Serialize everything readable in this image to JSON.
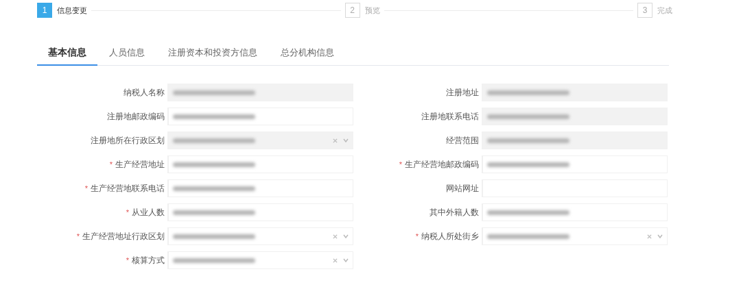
{
  "steps": [
    {
      "number": "1",
      "label": "信息变更",
      "selected": true
    },
    {
      "number": "2",
      "label": "预览",
      "selected": false
    },
    {
      "number": "3",
      "label": "完成",
      "selected": false
    }
  ],
  "tabs": [
    {
      "label": "基本信息",
      "selected": true
    },
    {
      "label": "人员信息",
      "selected": false
    },
    {
      "label": "注册资本和投资方信息",
      "selected": false
    },
    {
      "label": "总分机构信息",
      "selected": false
    }
  ],
  "form_left": [
    {
      "label": "纳税人名称",
      "kind": "readonly",
      "value_redacted": true
    },
    {
      "label": "注册地邮政编码",
      "kind": "input",
      "value_redacted": true
    },
    {
      "label": "注册地所在行政区划",
      "kind": "readonly_select",
      "value_redacted": true
    },
    {
      "label": "生产经营地址",
      "required_mark": "*",
      "kind": "input",
      "value_redacted": true
    },
    {
      "label": "生产经营地联系电话",
      "required_mark": "*",
      "kind": "input",
      "value_redacted": true
    },
    {
      "label": "从业人数",
      "required_mark": "*",
      "kind": "input",
      "value_redacted": true
    },
    {
      "label": "生产经营地址行政区划",
      "required_mark": "*",
      "kind": "select",
      "value_redacted": true
    },
    {
      "label": "核算方式",
      "required_mark": "*",
      "kind": "select",
      "value_redacted": true
    }
  ],
  "form_right": [
    {
      "label": "注册地址",
      "kind": "readonly",
      "value_redacted": true
    },
    {
      "label": "注册地联系电话",
      "kind": "readonly",
      "value_redacted": true
    },
    {
      "label": "经营范围",
      "kind": "readonly",
      "value_redacted": true
    },
    {
      "label": "生产经营地邮政编码",
      "required_mark": "*",
      "kind": "input",
      "value_redacted": true
    },
    {
      "label": "网站网址",
      "kind": "input",
      "value_redacted": false
    },
    {
      "label": "其中外籍人数",
      "kind": "input",
      "value_redacted": true
    },
    {
      "label": "纳税人所处街乡",
      "required_mark": "*",
      "kind": "select",
      "value_redacted": true
    }
  ]
}
